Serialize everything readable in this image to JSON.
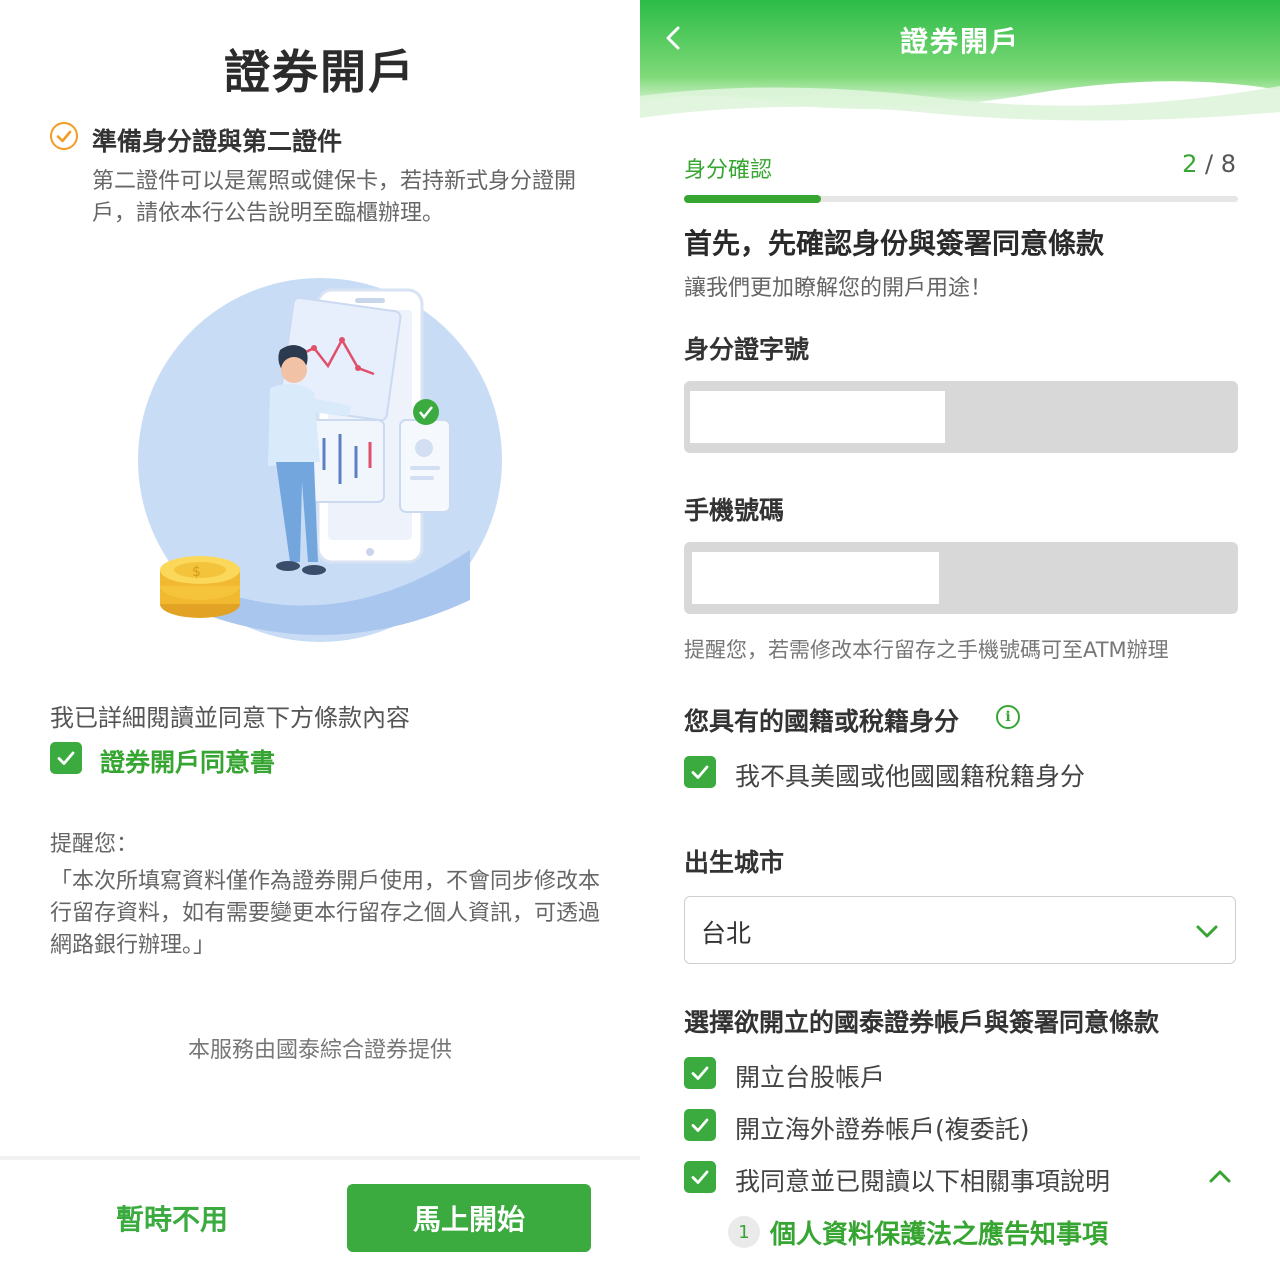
{
  "left": {
    "title": "證券開戶",
    "prepare": {
      "title": "準備身分證與第二證件",
      "description": "第二證件可以是駕照或健保卡，若持新式身分證開戶，請依本行公告說明至臨櫃辦理。"
    },
    "agreement": {
      "intro": "我已詳細閱讀並同意下方條款內容",
      "document": "證券開戶同意書"
    },
    "reminder": {
      "label": "提醒您：",
      "text": "「本次所填寫資料僅作為證券開戶使用，不會同步修改本行留存資料，如有需要變更本行留存之個人資訊，可透過網路銀行辦理。」"
    },
    "provider": "本服務由國泰綜合證券提供",
    "buttons": {
      "later": "暫時不用",
      "start": "馬上開始"
    },
    "colors": {
      "accent": "#3bab3f",
      "check_orange": "#f39b25"
    }
  },
  "right": {
    "header": {
      "title": "證券開戶"
    },
    "step": {
      "label": "身分確認",
      "current": "2",
      "separator": "/",
      "total": "8",
      "progress": 0.25
    },
    "heading": "首先，先確認身份與簽署同意條款",
    "subheading": "讓我們更加瞭解您的開戶用途！",
    "fields": {
      "id_label": "身分證字號",
      "id_value": "",
      "phone_label": "手機號碼",
      "phone_value": "",
      "phone_hint": "提醒您，若需修改本行留存之手機號碼可至ATM辦理"
    },
    "nationality": {
      "label": "您具有的國籍或稅籍身分",
      "info_icon": "i",
      "option": "我不具美國或他國國籍稅籍身分"
    },
    "birth_city": {
      "label": "出生城市",
      "value": "台北"
    },
    "accounts": {
      "label": "選擇欲開立的國泰證券帳戶與簽署同意條款",
      "options": [
        "開立台股帳戶",
        "開立海外證券帳戶(複委託)",
        "我同意並已閱讀以下相關事項說明"
      ]
    },
    "notices": [
      {
        "number": "1",
        "title": "個人資料保護法之應告知事項"
      }
    ],
    "colors": {
      "header_green_start": "#2fbf4a",
      "header_green_end": "#6ad66c",
      "accent": "#37a532"
    }
  }
}
